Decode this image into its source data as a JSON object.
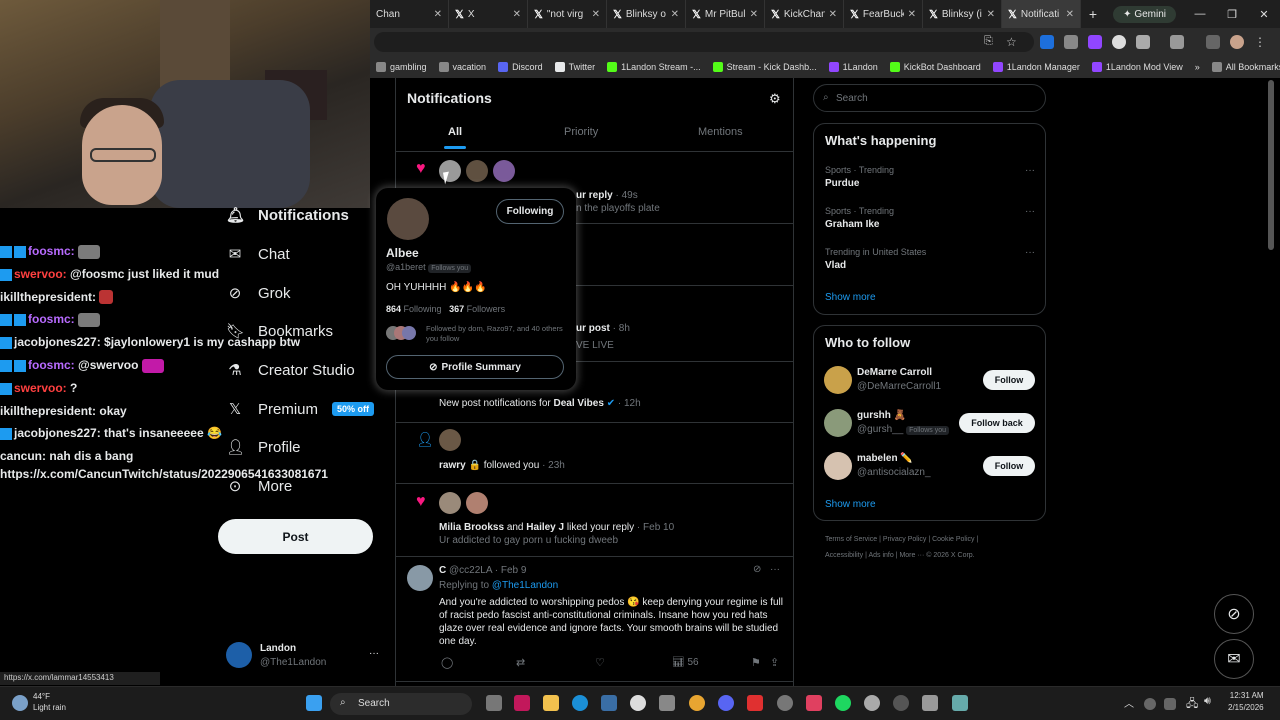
{
  "browser": {
    "tabs": [
      {
        "title": "Chan"
      },
      {
        "title": "X"
      },
      {
        "title": "\"not virg"
      },
      {
        "title": "Blinksy o"
      },
      {
        "title": "Mr PitBul"
      },
      {
        "title": "KickChan"
      },
      {
        "title": "FearBuck"
      },
      {
        "title": "Blinksy (i"
      },
      {
        "title": "Notificati"
      }
    ],
    "gemini_label": "Gemini",
    "bookmarks": [
      {
        "label": "gambling",
        "color": "#888"
      },
      {
        "label": "vacation",
        "color": "#888"
      },
      {
        "label": "Discord",
        "color": "#5865f2"
      },
      {
        "label": "Twitter",
        "color": "#e7e9ea"
      },
      {
        "label": "1Landon Stream -...",
        "color": "#53fc18"
      },
      {
        "label": "Stream - Kick Dashb...",
        "color": "#53fc18"
      },
      {
        "label": "1Landon",
        "color": "#9146ff"
      },
      {
        "label": "KickBot Dashboard",
        "color": "#53fc18"
      },
      {
        "label": "1Landon Manager",
        "color": "#9146ff"
      },
      {
        "label": "1Landon Mod View",
        "color": "#9146ff"
      }
    ],
    "all_bookmarks": "All Bookmarks",
    "status_url": "https://x.com/lammar14553413"
  },
  "chat": [
    {
      "user": "foosmc:",
      "color": "#b86bff",
      "msg": "",
      "emote": true
    },
    {
      "user": "swervoo:",
      "color": "#ff4040",
      "msg": "@foosmc just liked it mud"
    },
    {
      "user": "ikillthepresident:",
      "color": "#e7e9ea",
      "msg": "",
      "emote": true
    },
    {
      "user": "foosmc:",
      "color": "#b86bff",
      "msg": "",
      "emote": true
    },
    {
      "user": "jacobjones227:",
      "color": "#e7e9ea",
      "msg": "$jaylonlowery1 is my cashapp btw"
    },
    {
      "user": "foosmc:",
      "color": "#b86bff",
      "msg": "@swervoo",
      "emote": true
    },
    {
      "user": "swervoo:",
      "color": "#ff4040",
      "msg": "?"
    },
    {
      "user": "ikillthepresident:",
      "color": "#e7e9ea",
      "msg": "okay"
    },
    {
      "user": "jacobjones227:",
      "color": "#e7e9ea",
      "msg": "that's insaneeeee 😂"
    },
    {
      "user": "cancun:",
      "color": "#e7e9ea",
      "msg": "nah dis a bang"
    },
    {
      "user": "",
      "color": "#e7e9ea",
      "msg": "https://x.com/CancunTwitch/status/2022906541633081671"
    }
  ],
  "nav": {
    "notifications": "Notifications",
    "chat": "Chat",
    "grok": "Grok",
    "bookmarks": "Bookmarks",
    "creator_studio": "Creator Studio",
    "premium": "Premium",
    "premium_badge": "50% off",
    "profile": "Profile",
    "more": "More",
    "post": "Post",
    "account_name": "Landon",
    "account_handle": "@The1Landon"
  },
  "notifications": {
    "title": "Notifications",
    "tabs": [
      "All",
      "Priority",
      "Mentions"
    ],
    "n1_frag": "ur reply",
    "n1_time": "· 49s",
    "n1_sub": "n the playoffs plate",
    "n2_frag": "ur post",
    "n2_time": "· 8h",
    "n2_sub": "VE LIVE",
    "n3_text": "New post notifications for ",
    "n3_name": "Deal Vibes",
    "n3_time": "· 12h",
    "n4_name": "rawry",
    "n4_text": "followed you",
    "n4_time": "· 23h",
    "n5_name1": "Milia Brookss",
    "n5_and": "and",
    "n5_name2": "Hailey J",
    "n5_text": "liked your reply",
    "n5_time": "· Feb 10",
    "n5_sub": "Ur addicted to gay porn u fucking dweeb",
    "reply_name": "C",
    "reply_handle": "@cc22LA",
    "reply_time": "· Feb 9",
    "reply_to_label": "Replying to",
    "reply_to": "@The1Landon",
    "reply_body": "And you're addicted to worshipping pedos 😘 keep denying your regime is full of racist pedo fascist anti-constitutional criminals. Insane how you red hats glaze over real evidence and ignore facts. Your smooth brains will be studied one day.",
    "views": "56"
  },
  "popup": {
    "name": "Albee",
    "handle": "@a1beret",
    "follows_you": "Follows you",
    "bio": "OH YUHHHH 🔥🔥🔥",
    "following_count": "864",
    "following_label": "Following",
    "followers_count": "367",
    "followers_label": "Followers",
    "followed_by": "Followed by dom, Razo97, and 40 others you follow",
    "follow_btn": "Following",
    "summary_btn": "Profile Summary"
  },
  "right": {
    "search_placeholder": "Search",
    "happening_title": "What's happening",
    "trends": [
      {
        "context": "Sports · Trending",
        "name": "Purdue"
      },
      {
        "context": "Sports · Trending",
        "name": "Graham Ike"
      },
      {
        "context": "Trending in United States",
        "name": "Vlad"
      }
    ],
    "show_more": "Show more",
    "wtf_title": "Who to follow",
    "follows": [
      {
        "name": "DeMarre Carroll",
        "handle": "@DeMarreCarroll1",
        "btn": "Follow",
        "tag": ""
      },
      {
        "name": "gurshh 🧸",
        "handle": "@gursh__",
        "btn": "Follow back",
        "tag": "Follows you"
      },
      {
        "name": "mabelen ✏️",
        "handle": "@antisocialazn_",
        "btn": "Follow",
        "tag": ""
      }
    ],
    "footer_line1": "Terms of Service  |  Privacy Policy  |  Cookie Policy  |",
    "footer_line2": "Accessibility  |  Ads info  |  More ···  © 2026 X Corp."
  },
  "taskbar": {
    "temp": "44°F",
    "weather": "Light rain",
    "search": "Search",
    "time": "12:31 AM",
    "date": "2/15/2026"
  }
}
